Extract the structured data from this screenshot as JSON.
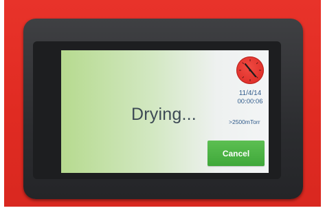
{
  "screen": {
    "status": "Drying...",
    "date": "11/4/14",
    "time": "00:00:06",
    "pressure": ">2500mTorr",
    "cancel_label": "Cancel"
  },
  "colors": {
    "housing": "#e02b22",
    "bezel": "#2c2d30",
    "screen_green": "#b6da8f",
    "screen_white": "#f3f5f6",
    "status_text": "#3d4a55",
    "info_text": "#2f5a8a",
    "button": "#4cb446",
    "dial": "#e0312b"
  },
  "icons": {
    "dial": "clock-dial-icon"
  }
}
